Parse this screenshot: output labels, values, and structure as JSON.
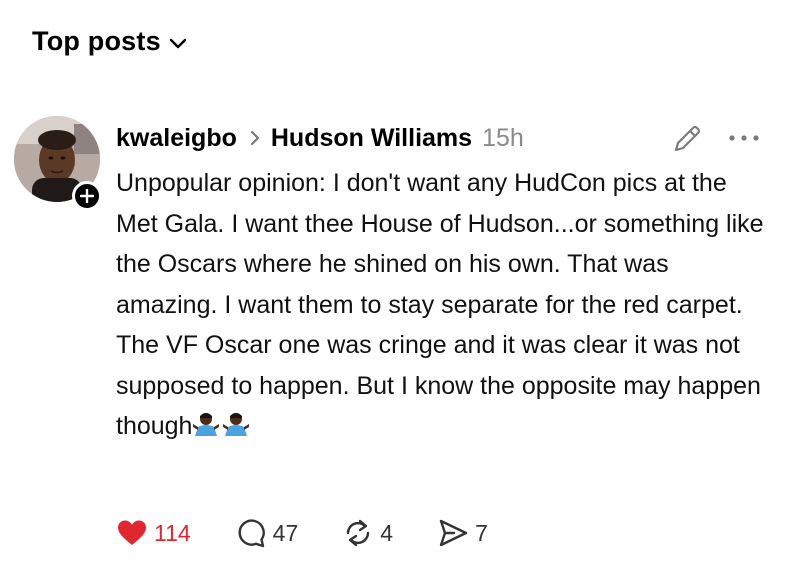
{
  "feed": {
    "section_label": "Top posts"
  },
  "post": {
    "username": "kwaleigbo",
    "reply_to": "Hudson Williams",
    "time": "15h",
    "text": "Unpopular opinion: I don't want any HudCon pics at the Met Gala. I want thee House of Hudson...or something like the Oscars where he shined on his own. That was amazing. I want them to stay separate for the red carpet. The VF Oscar one was cringe and it was clear it was not supposed to happen. But I know the opposite may happen though",
    "emoji": "🤷🏿‍♂️🤷🏿‍♂️",
    "actions": {
      "likes": "114",
      "comments": "47",
      "reposts": "4",
      "shares": "7"
    }
  },
  "colors": {
    "like": "#e0262f",
    "muted": "#8a8a8a",
    "text": "#111111"
  },
  "icons": [
    "chevron-down-icon",
    "plus-icon",
    "chevron-right-icon",
    "pencil-icon",
    "more-icon",
    "heart-icon",
    "comment-icon",
    "repost-icon",
    "share-icon",
    "shrug-emoji"
  ]
}
